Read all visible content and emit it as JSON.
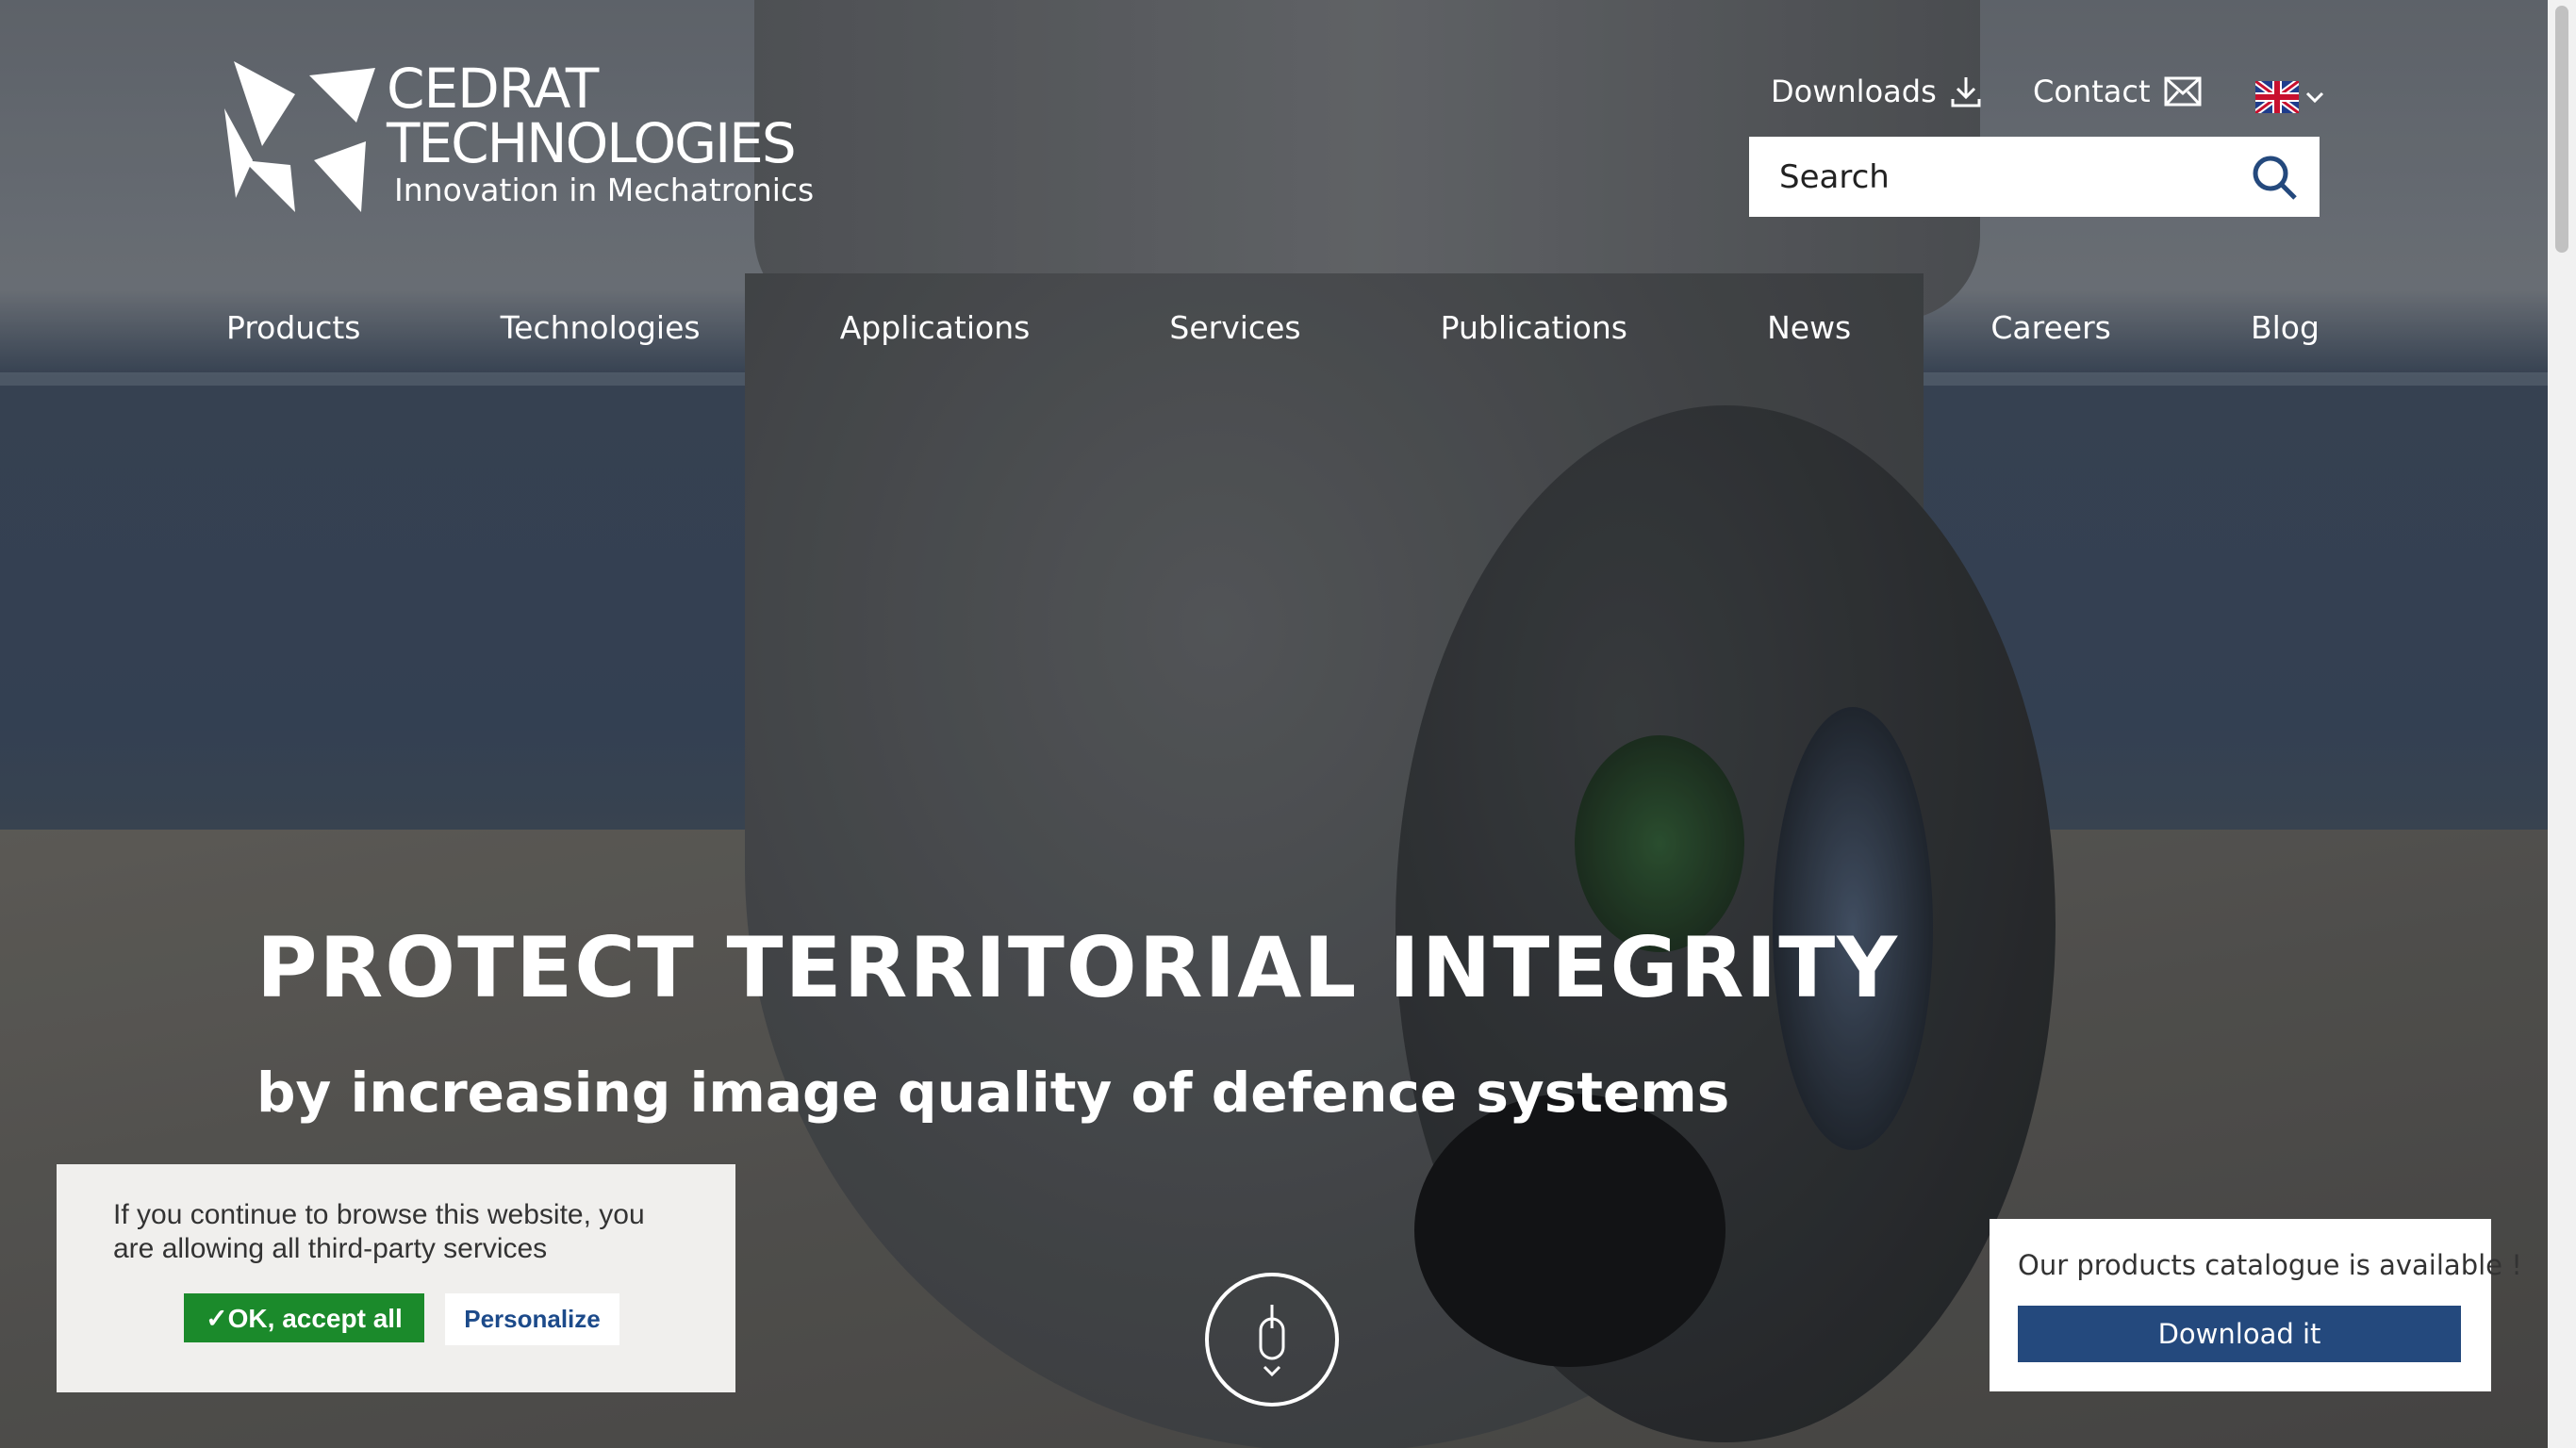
{
  "brand": {
    "name_line1": "CEDRAT",
    "name_line2": "TECHNOLOGIES",
    "tagline": "Innovation in Mechatronics"
  },
  "utility": {
    "downloads_label": "Downloads",
    "contact_label": "Contact",
    "language": "English (UK flag)"
  },
  "search": {
    "placeholder": "Search"
  },
  "nav": {
    "items": [
      {
        "label": "Products"
      },
      {
        "label": "Technologies"
      },
      {
        "label": "Applications"
      },
      {
        "label": "Services"
      },
      {
        "label": "Publications"
      },
      {
        "label": "News"
      },
      {
        "label": "Careers"
      },
      {
        "label": "Blog"
      }
    ]
  },
  "hero": {
    "title": "PROTECT TERRITORIAL INTEGRITY",
    "subtitle": "by increasing image quality of defence systems"
  },
  "cookie": {
    "message": "If you continue to browse this website, you are allowing all third-party services",
    "accept_label": "✓OK, accept all",
    "personalize_label": "Personalize"
  },
  "catalogue": {
    "message": "Our products catalogue is available !",
    "button_label": "Download it"
  },
  "icons": {
    "download": "download-icon",
    "contact": "envelope-icon",
    "language": "uk-flag-icon",
    "search": "search-icon",
    "scroll": "mouse-scroll-icon"
  },
  "colors": {
    "accept_green": "#1b8a2b",
    "catalogue_blue": "#24497d",
    "personalize_text": "#1c4a8a"
  }
}
